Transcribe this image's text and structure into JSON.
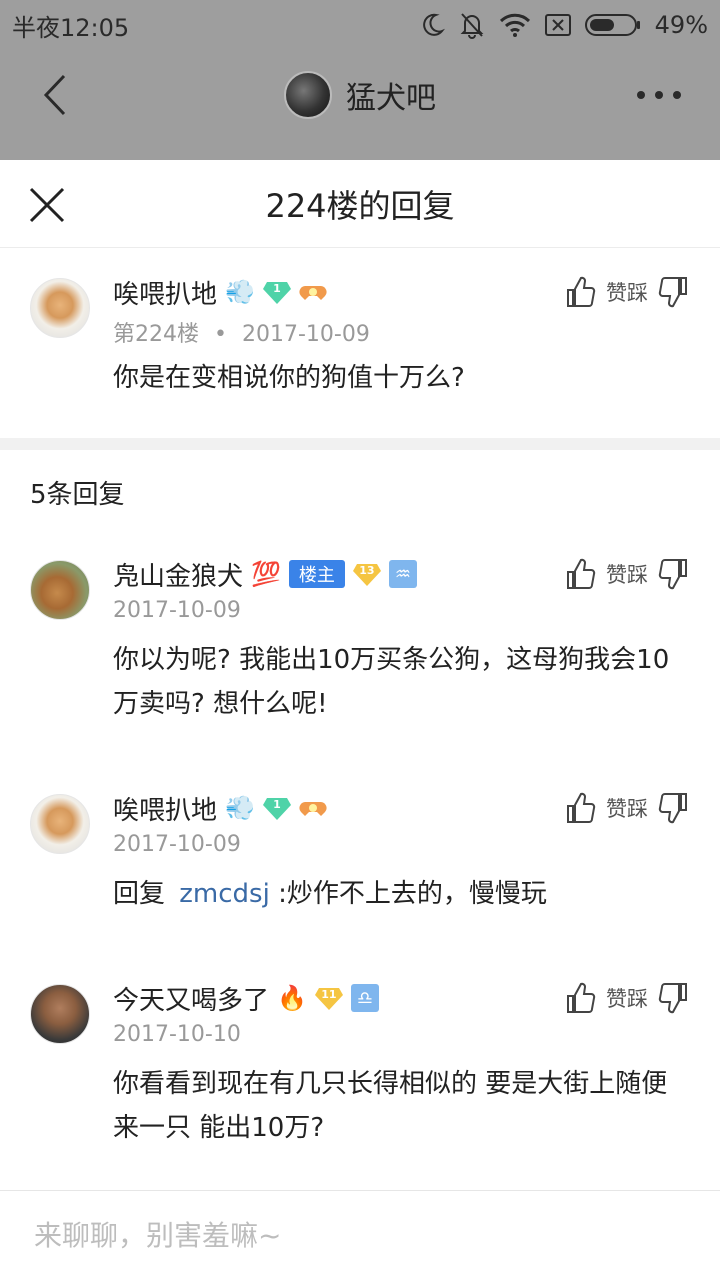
{
  "status_bar": {
    "time": "半夜12:05",
    "battery": "49%"
  },
  "navbar": {
    "forum_name": "猛犬吧"
  },
  "sheet": {
    "title": "224楼的回复"
  },
  "main_post": {
    "username": "唉喂扒地",
    "name_emoji": "💨",
    "level": "1",
    "floor": "第224楼",
    "separator": "•",
    "date": "2017-10-09",
    "content": "你是在变相说你的狗值十万么?",
    "vote_label": "赞踩"
  },
  "replies_count": "5条回复",
  "replies": [
    {
      "username": "凫山金狼犬",
      "name_emoji": "💯",
      "host_tag": "楼主",
      "level": "13",
      "zodiac": "♒",
      "date": "2017-10-09",
      "content": "你以为呢? 我能出10万买条公狗，这母狗我会10万卖吗? 想什么呢!",
      "vote_label": "赞踩"
    },
    {
      "username": "唉喂扒地",
      "name_emoji": "💨",
      "level": "1",
      "date": "2017-10-09",
      "reply_prefix": "回复",
      "reply_to": "zmcdsj",
      "content": " :炒作不上去的，慢慢玩",
      "vote_label": "赞踩"
    },
    {
      "username": "今天又喝多了",
      "name_emoji": "🔥",
      "level": "11",
      "zodiac": "♎",
      "date": "2017-10-10",
      "content": "你看看到现在有几只长得相似的 要是大街上随便来一只 能出10万?",
      "vote_label": "赞踩"
    }
  ],
  "input": {
    "placeholder": "来聊聊，别害羞嘛~"
  },
  "colors": {
    "dim_overlay": "#9e9e9e",
    "link_blue": "#3a6aa6",
    "host_tag_blue": "#3a83e8",
    "meta_gray": "#999999"
  }
}
